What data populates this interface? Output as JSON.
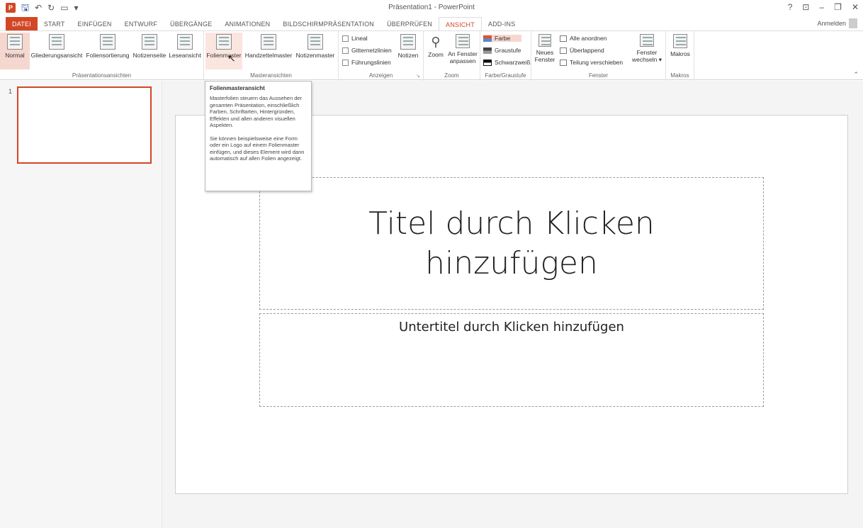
{
  "titlebar": {
    "window_title": "Präsentation1 - PowerPoint",
    "help": "?",
    "ribbon_options": "⊡",
    "minimize": "–",
    "restore": "❐",
    "close": "✕"
  },
  "tabs": [
    {
      "label": "DATEI"
    },
    {
      "label": "START"
    },
    {
      "label": "EINFÜGEN"
    },
    {
      "label": "ENTWURF"
    },
    {
      "label": "ÜBERGÄNGE"
    },
    {
      "label": "ANIMATIONEN"
    },
    {
      "label": "BILDSCHIRMPRÄSENTATION"
    },
    {
      "label": "ÜBERPRÜFEN"
    },
    {
      "label": "ANSICHT"
    },
    {
      "label": "ADD-INS"
    }
  ],
  "signin": "Anmelden",
  "ribbon": {
    "presentation_views": {
      "label": "Präsentationsansichten",
      "normal": "Normal",
      "outline": "Gliederungsansicht",
      "sorter": "Foliensortierung",
      "notes_page": "Notizenseite",
      "reading": "Leseansicht"
    },
    "master_views": {
      "label": "Masteransichten",
      "slide_master": "Folienmaster",
      "handout_master": "Handzettelmaster",
      "notes_master": "Notizenmaster"
    },
    "show": {
      "label": "Anzeigen",
      "ruler": "Lineal",
      "gridlines": "Gitternetzlinien",
      "guides": "Führungslinien",
      "notes": "Notizen"
    },
    "zoom": {
      "label": "Zoom",
      "zoom": "Zoom",
      "fit_line1": "An Fenster",
      "fit_line2": "anpassen"
    },
    "color": {
      "label": "Farbe/Graustufe",
      "color": "Farbe",
      "grayscale": "Graustufe",
      "bw": "Schwarzweiß"
    },
    "window": {
      "label": "Fenster",
      "new_line1": "Neues",
      "new_line2": "Fenster",
      "arrange_all": "Alle anordnen",
      "cascade": "Überlappend",
      "move_split": "Teilung verschieben",
      "switch_line1": "Fenster",
      "switch_line2": "wechseln ▾"
    },
    "macros": {
      "label": "Makros",
      "macros": "Makros"
    }
  },
  "tooltip": {
    "title": "Folienmasteransicht",
    "para1": "Masterfolien steuern das Aussehen der gesamten Präsentation, einschließlich Farben, Schriftarten, Hintergründen, Effekten und allen anderen visuellen Aspekten.",
    "para2": "Sie können beispielsweise eine Form oder ein Logo auf einem Folienmaster einfügen, und dieses Element wird dann automatisch auf allen Folien angezeigt."
  },
  "thumbnails": [
    {
      "number": "1"
    }
  ],
  "slide": {
    "title_placeholder": "Titel durch Klicken hinzufügen",
    "subtitle_placeholder": "Untertitel durch Klicken hinzufügen"
  },
  "colors": {
    "accent": "#d24726",
    "ribbon_selected": "#f6d7cf"
  }
}
